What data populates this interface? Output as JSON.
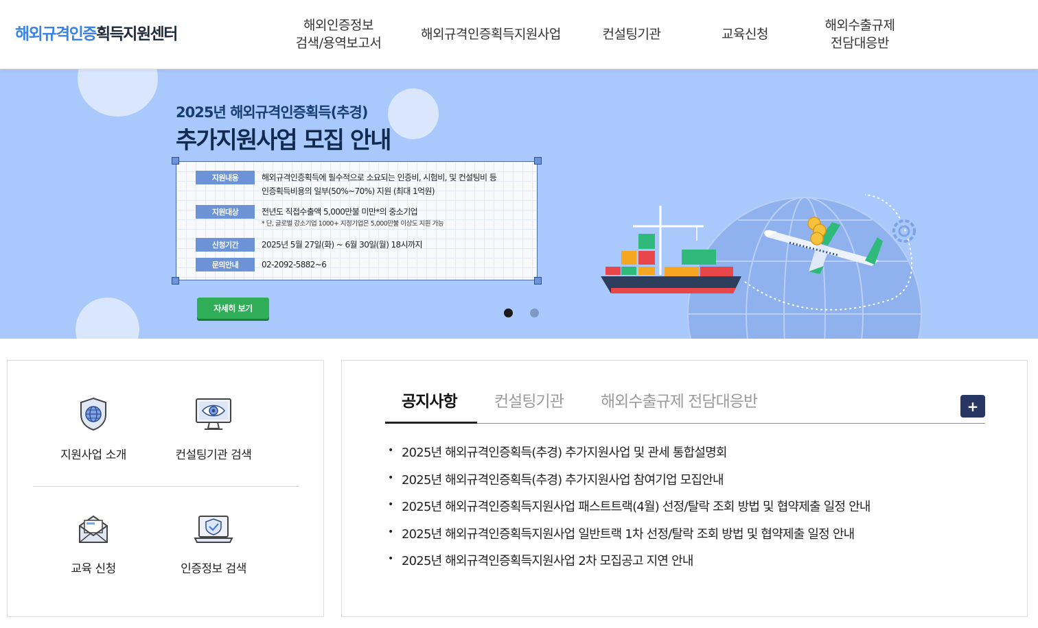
{
  "header": {
    "logo_accent": "해외규격인증",
    "logo_rest": "획득지원센터",
    "nav": [
      {
        "label": "해외인증정보\n검색/용역보고서"
      },
      {
        "label": "해외규격인증획득지원사업"
      },
      {
        "label": "컨설팅기관"
      },
      {
        "label": "교육신청"
      },
      {
        "label": "해외수출규제\n전담대응반"
      }
    ]
  },
  "banner": {
    "subtitle": "2025년 해외규격인증획득(추경)",
    "title": "추가지원사업 모집 안내",
    "rows": [
      {
        "tag": "지원내용",
        "lines": [
          "해외규격인증획득에 필수적으로 소요되는 인증비, 시험비, 및 컨설팅비 등",
          "인증획득비용의 일부(50%~70%) 지원 (최대 1억원)"
        ]
      },
      {
        "tag": "지원대상",
        "lines": [
          "전년도 직접수출액 5,000만불 미만*의 중소기업"
        ],
        "note": "* 단, 글로벌 강소기업 1000+ 지정기업은 5,000만불 이상도 지원 가능"
      },
      {
        "tag": "신청기간",
        "lines": [
          "2025년 5월 27일(화) ~ 6월 30일(월) 18시까지"
        ]
      },
      {
        "tag": "문의안내",
        "lines": [
          "02-2092-5882~6"
        ]
      }
    ],
    "detail_button": "자세히 보기",
    "slides": 2,
    "active_slide": 1
  },
  "quick_menu": {
    "items": [
      {
        "label": "지원사업 소개",
        "icon": "globe-shield-icon"
      },
      {
        "label": "컨설팅기관 검색",
        "icon": "monitor-eye-icon"
      },
      {
        "label": "교육 신청",
        "icon": "envelope-icon"
      },
      {
        "label": "인증정보 검색",
        "icon": "laptop-check-icon"
      }
    ]
  },
  "board": {
    "tabs": [
      "공지사항",
      "컨설팅기관",
      "해외수출규제 전담대응반"
    ],
    "active_tab": 0,
    "more_label": "+",
    "notices": [
      "2025년 해외규격인증획득(추경) 추가지원사업 및 관세 통합설명회",
      "2025년 해외규격인증획득(추경) 추가지원사업 참여기업 모집안내",
      "2025년 해외규격인증획득지원사업 패스트트랙(4월) 선정/탈락 조회 방법 및 협약제출 일정 안내",
      "2025년 해외규격인증획득지원사업 일반트랙 1차 선정/탈락 조회 방법 및 협약제출 일정 안내",
      "2025년 해외규격인증획득지원사업 2차 모집공고 지연 안내"
    ]
  },
  "colors": {
    "logo_blue": "#3b82e6",
    "banner_bg": "#a9c8fb",
    "tag_blue": "#6b93d6",
    "detail_green": "#2fae57",
    "plus_navy": "#283663"
  }
}
